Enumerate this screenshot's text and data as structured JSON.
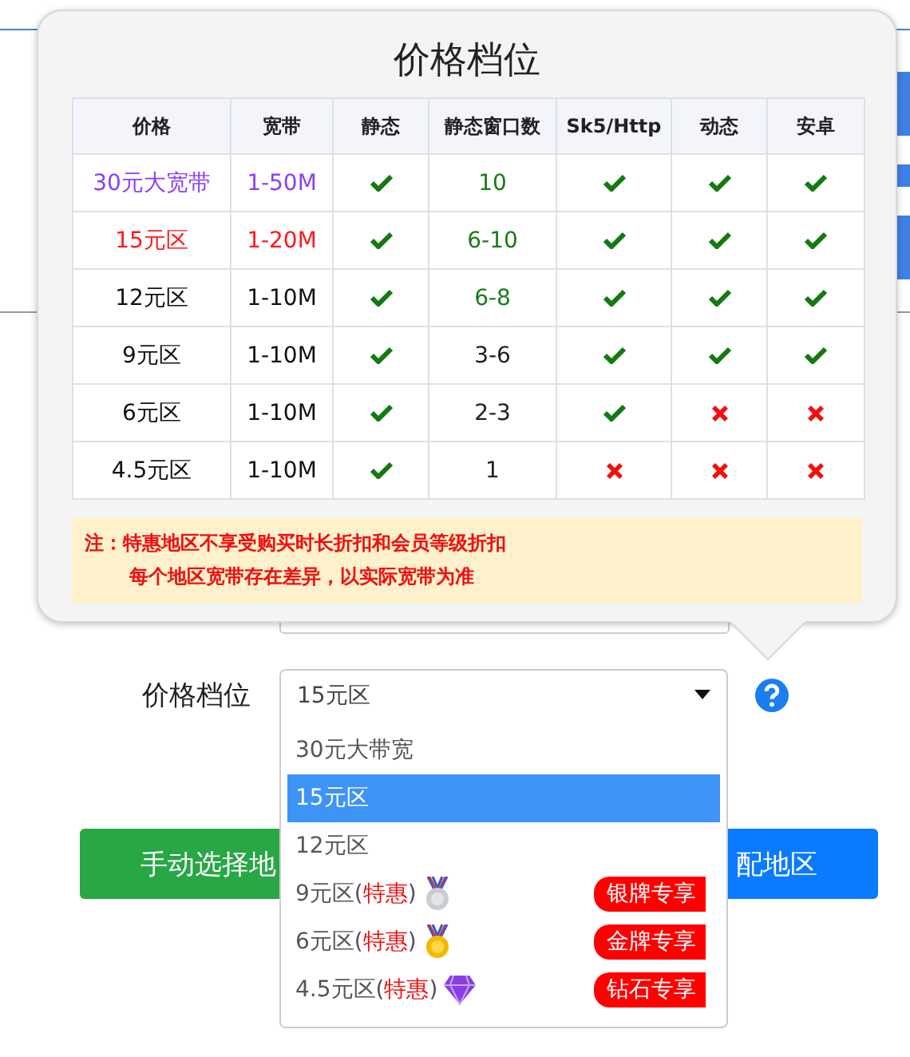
{
  "popover": {
    "title": "价格档位",
    "columns": [
      "价格",
      "宽带",
      "静态",
      "静态窗口数",
      "Sk5/Http",
      "动态",
      "安卓"
    ],
    "rows": [
      {
        "price": "30元大宽带",
        "bandwidth": "1-50M",
        "color": "#8a3ffc",
        "static": true,
        "windows": "10",
        "windows_highlighted": true,
        "sk5": true,
        "dynamic": true,
        "android": true
      },
      {
        "price": "15元区",
        "bandwidth": "1-20M",
        "color": "#ff1a1a",
        "static": true,
        "windows": "6-10",
        "windows_highlighted": true,
        "sk5": true,
        "dynamic": true,
        "android": true
      },
      {
        "price": "12元区",
        "bandwidth": "1-10M",
        "color": "#111111",
        "static": true,
        "windows": "6-8",
        "windows_highlighted": true,
        "sk5": true,
        "dynamic": true,
        "android": true
      },
      {
        "price": "9元区",
        "bandwidth": "1-10M",
        "color": "#111111",
        "static": true,
        "windows": "3-6",
        "windows_highlighted": false,
        "sk5": true,
        "dynamic": true,
        "android": true
      },
      {
        "price": "6元区",
        "bandwidth": "1-10M",
        "color": "#111111",
        "static": true,
        "windows": "2-3",
        "windows_highlighted": false,
        "sk5": true,
        "dynamic": false,
        "android": false
      },
      {
        "price": "4.5元区",
        "bandwidth": "1-10M",
        "color": "#111111",
        "static": true,
        "windows": "1",
        "windows_highlighted": false,
        "sk5": false,
        "dynamic": false,
        "android": false
      }
    ],
    "note": [
      "注：特惠地区不享受购买时长折扣和会员等级折扣",
      "每个地区宽带存在差异，以实际宽带为准"
    ]
  },
  "price_select": {
    "label": "价格档位",
    "value": "15元区",
    "options": [
      {
        "label": "30元大带宽",
        "selected": false
      },
      {
        "label": "15元区",
        "selected": true
      },
      {
        "label": "12元区",
        "selected": false
      },
      {
        "label": "9元区(",
        "tag": "特惠",
        "after": ")",
        "kind": "silver",
        "badge": "银牌专享",
        "selected": false
      },
      {
        "label": "6元区(",
        "tag": "特惠",
        "after": ")",
        "kind": "gold",
        "badge": "金牌专享",
        "selected": false
      },
      {
        "label": "4.5元区(",
        "tag": "特惠",
        "after": ")",
        "kind": "diamond",
        "badge": "钻石专享",
        "selected": false
      }
    ]
  },
  "buttons": [
    {
      "label": "手动选择地",
      "kind": "green"
    },
    {
      "label": "配地区",
      "kind": "blue"
    }
  ]
}
